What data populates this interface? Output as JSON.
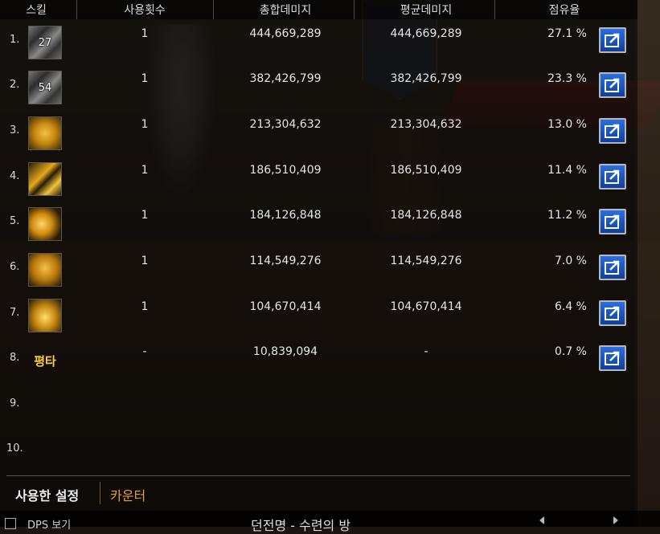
{
  "header": {
    "skill": "스킬",
    "uses": "사용횟수",
    "total": "총합데미지",
    "average": "평균데미지",
    "share": "점유율"
  },
  "rows": [
    {
      "rank": "1.",
      "icon": "skill-gray-icon",
      "icon_label": "27",
      "uses": "1",
      "total": "444,669,289",
      "average": "444,669,289",
      "share": "27.1 %"
    },
    {
      "rank": "2.",
      "icon": "skill-gray-icon",
      "icon_label": "54",
      "uses": "1",
      "total": "382,426,799",
      "average": "382,426,799",
      "share": "23.3 %"
    },
    {
      "rank": "3.",
      "icon": "skill-gold-icon",
      "icon_label": "",
      "uses": "1",
      "total": "213,304,632",
      "average": "213,304,632",
      "share": "13.0 %"
    },
    {
      "rank": "4.",
      "icon": "skill-gold-slash-icon",
      "icon_label": "",
      "uses": "1",
      "total": "186,510,409",
      "average": "186,510,409",
      "share": "11.4 %"
    },
    {
      "rank": "5.",
      "icon": "skill-gold-burst-icon",
      "icon_label": "",
      "uses": "1",
      "total": "184,126,848",
      "average": "184,126,848",
      "share": "11.2 %"
    },
    {
      "rank": "6.",
      "icon": "skill-gold-palm-icon",
      "icon_label": "",
      "uses": "1",
      "total": "114,549,276",
      "average": "114,549,276",
      "share": "7.0 %"
    },
    {
      "rank": "7.",
      "icon": "skill-gold-swirl-icon",
      "icon_label": "",
      "uses": "1",
      "total": "104,670,414",
      "average": "104,670,414",
      "share": "6.4 %"
    },
    {
      "rank": "8.",
      "icon": "text-icon",
      "icon_label": "평타",
      "uses": "-",
      "total": "10,839,094",
      "average": "-",
      "share": "0.7 %"
    },
    {
      "rank": "9.",
      "icon": "",
      "icon_label": "",
      "uses": "",
      "total": "",
      "average": "",
      "share": ""
    },
    {
      "rank": "10.",
      "icon": "",
      "icon_label": "",
      "uses": "",
      "total": "",
      "average": "",
      "share": ""
    }
  ],
  "tabs": {
    "used_settings": "사용한 설정",
    "counter": "카운터"
  },
  "footer": {
    "dps_label": "DPS 보기",
    "dungeon_label": "던전명 - 수련의 방"
  },
  "colors": {
    "accent_gold": "#e9a12a",
    "share_button": "#2a6ee0"
  }
}
